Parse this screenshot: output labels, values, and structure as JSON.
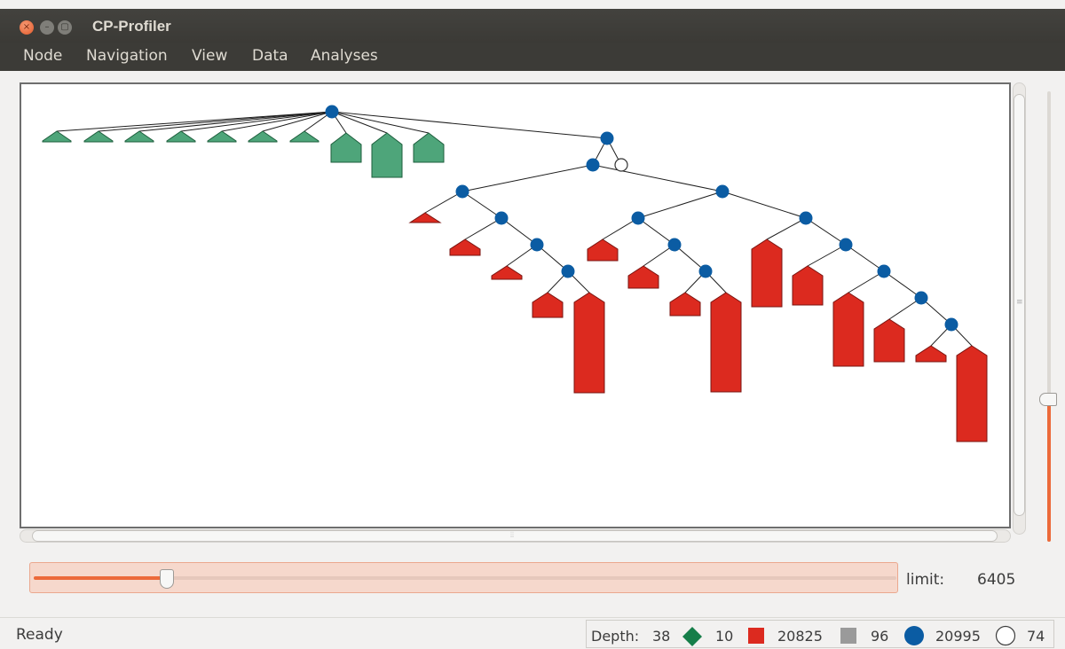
{
  "window": {
    "title": "CP-Profiler"
  },
  "menu": {
    "items": [
      {
        "label": "Node",
        "name": "menu-node"
      },
      {
        "label": "Navigation",
        "name": "menu-navigation"
      },
      {
        "label": "View",
        "name": "menu-view"
      },
      {
        "label": "Data",
        "name": "menu-data"
      },
      {
        "label": "Analyses",
        "name": "menu-analyses"
      }
    ]
  },
  "colors": {
    "branch_node": "#0b5ca3",
    "failed": "#dc2a1f",
    "solution": "#167e49",
    "solution_subtree": "#4ea57a",
    "skipped": "#9a9a9a",
    "undetermined": "#ffffff",
    "accent": "#ec6a3a"
  },
  "depth_limit": {
    "label": "limit:",
    "value": "6405",
    "slider_position": 0.155
  },
  "zoom": {
    "slider_position": 0.31
  },
  "status": {
    "text": "Ready",
    "depth_label": "Depth:",
    "depth_value": "38",
    "solved_count": "10",
    "failed_count": "20825",
    "skipped_count": "96",
    "branch_count": "20995",
    "undetermined_count": "74",
    "icons": {
      "solved": "green-diamond-icon",
      "failed": "red-square-icon",
      "skipped": "gray-square-icon",
      "branch": "blue-circle-icon",
      "undetermined": "white-circle-icon"
    }
  }
}
